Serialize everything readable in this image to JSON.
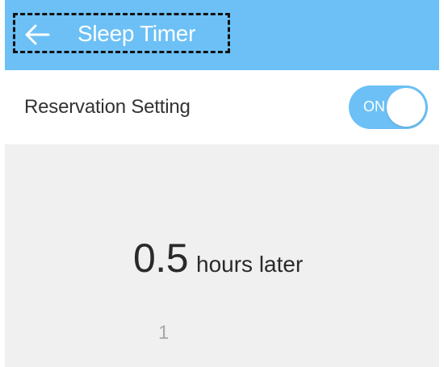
{
  "header": {
    "title": "Sleep Timer",
    "back_icon": "arrow-left-icon",
    "background": "#6cc0f6"
  },
  "reservation": {
    "label": "Reservation Setting",
    "toggle": {
      "state_label": "ON",
      "on": true,
      "color": "#6cc0f6"
    }
  },
  "picker": {
    "selected_value": "0.5",
    "unit": "hours later",
    "next_value": "1"
  }
}
